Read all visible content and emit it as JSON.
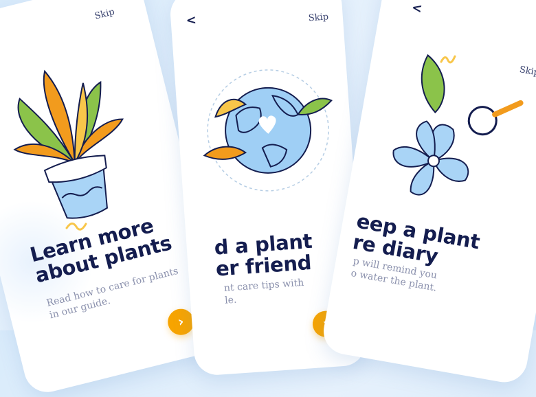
{
  "screens": [
    {
      "skip": "Skip",
      "back": "<",
      "title_lines": [
        "Learn more",
        "about plants"
      ],
      "body_lines": [
        "Read how to care for plants",
        "in our guide."
      ],
      "next": "›",
      "illustration": "potted-plant"
    },
    {
      "skip": "Skip",
      "back": "<",
      "title_lines": [
        "d a plant",
        "er friend"
      ],
      "body_lines": [
        "nt care tips with",
        "le."
      ],
      "next": "›",
      "illustration": "globe-with-heart"
    },
    {
      "skip": "Skip",
      "back": "<",
      "title_lines": [
        "eep a plant",
        "re diary"
      ],
      "body_lines": [
        "p will remind you",
        "o water the plant."
      ],
      "next": "›",
      "illustration": "flower-leaf-magnifier"
    }
  ],
  "colors": {
    "accent": "#f7a400",
    "title": "#141d4f",
    "body": "#8b91ad",
    "illustration_blue": "#9fcff5",
    "leaf_green": "#8bc34a",
    "leaf_orange": "#f29b1d"
  }
}
